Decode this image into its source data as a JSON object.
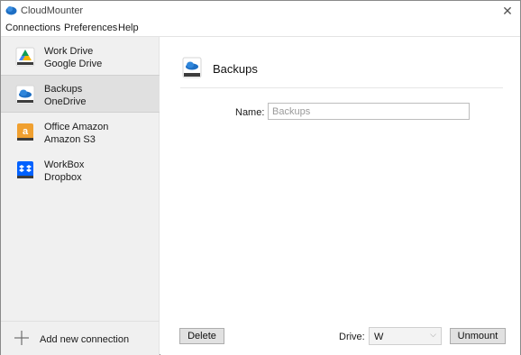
{
  "window": {
    "title": "CloudMounter"
  },
  "menu": {
    "items": [
      "Connections",
      "Preferences",
      "Help"
    ]
  },
  "sidebar": {
    "connections": [
      {
        "name": "Work Drive",
        "service": "Google Drive",
        "icon": "google-drive-icon"
      },
      {
        "name": "Backups",
        "service": "OneDrive",
        "icon": "onedrive-icon",
        "selected": true
      },
      {
        "name": "Office Amazon",
        "service": "Amazon S3",
        "icon": "amazon-s3-icon"
      },
      {
        "name": "WorkBox",
        "service": "Dropbox",
        "icon": "dropbox-icon"
      }
    ],
    "add_label": "Add new connection"
  },
  "main": {
    "title": "Backups",
    "name_label": "Name:",
    "name_value": "Backups",
    "delete_label": "Delete",
    "drive_label": "Drive:",
    "drive_value": "W",
    "unmount_label": "Unmount"
  },
  "colors": {
    "onedrive": "#1e6fc4",
    "google_blue": "#4285f4",
    "google_green": "#0f9d58",
    "google_yellow": "#f4b400",
    "amazon": "#f0a030",
    "dropbox": "#0061fe",
    "drive_base": "#3c3c3c"
  }
}
